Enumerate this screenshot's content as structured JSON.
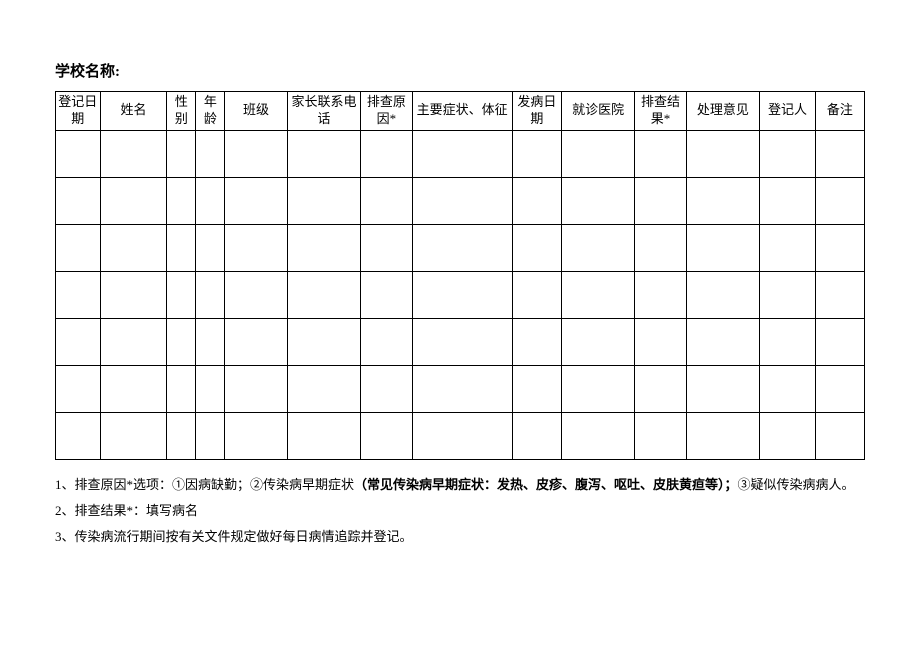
{
  "title_label": "学校名称:",
  "headers": {
    "reg_date": "登记日期",
    "name": "姓名",
    "gender": "性别",
    "age": "年龄",
    "class": "班级",
    "parent_phone": "家长联系电话",
    "screen_reason": "排查原因*",
    "symptoms": "主要症状、体征",
    "onset_date": "发病日期",
    "hospital": "就诊医院",
    "screen_result": "排查结果*",
    "opinion": "处理意见",
    "registrar": "登记人",
    "remark": "备注"
  },
  "notes": {
    "n1_prefix": "1、排查原因*选项：①因病缺勤；②传染病早期症状",
    "n1_bold": "（常见传染病早期症状：发热、皮疹、腹泻、呕吐、皮肤黄疸等）；",
    "n1_suffix": "③疑似传染病病人。",
    "n2": "2、排查结果*：填写病名",
    "n3": "3、传染病流行期间按有关文件规定做好每日病情追踪并登记。"
  }
}
